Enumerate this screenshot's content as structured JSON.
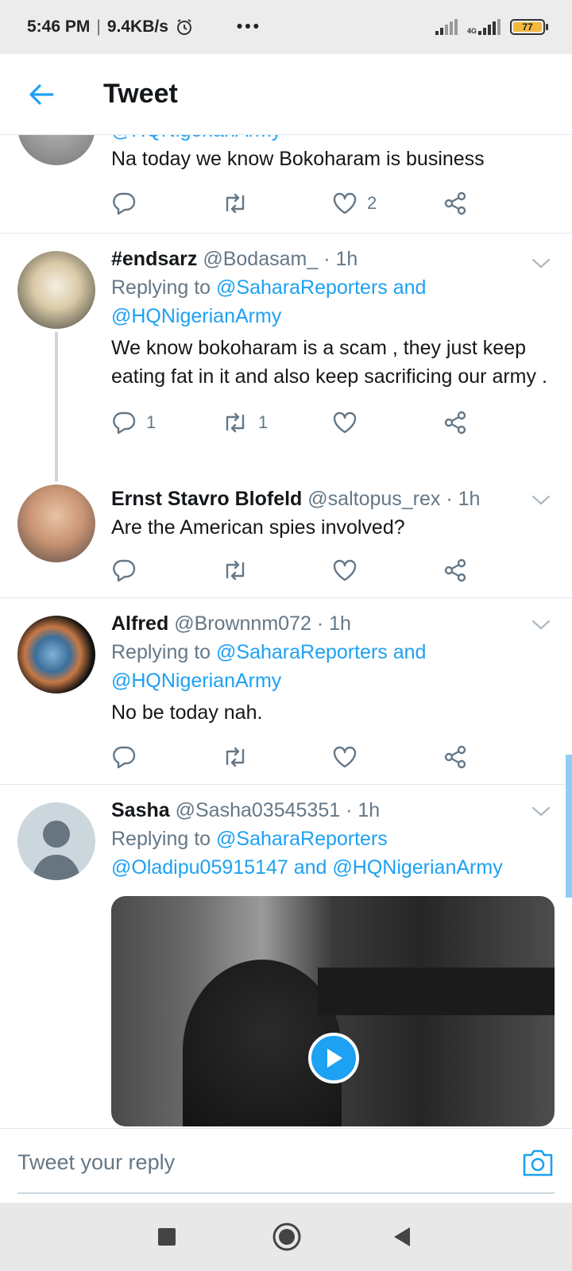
{
  "status_bar": {
    "time": "5:46 PM",
    "separator": "|",
    "speed": "9.4KB/s",
    "network_type": "4G",
    "battery": "77"
  },
  "header": {
    "title": "Tweet"
  },
  "tweets": [
    {
      "handle_partial": "@HQNigerianArmy",
      "body": "Na today we know Bokoharam is business",
      "likes": "2"
    },
    {
      "name": "#endsarz",
      "handle": "@Bodasam_",
      "time": "· 1h",
      "replying_prefix": "Replying to",
      "mentions_line1": "@SaharaReporters and",
      "mentions_line2": "@HQNigerianArmy",
      "body": "We know bokoharam is a scam , they just keep eating fat in it and also keep sacrificing our army .",
      "replies": "1",
      "retweets": "1"
    },
    {
      "name": "Ernst Stavro Blofeld",
      "handle": "@saltopus_rex",
      "time": "· 1h",
      "body": "Are the American spies involved?"
    },
    {
      "name": "Alfred",
      "handle": "@Brownnm072",
      "time": "· 1h",
      "replying_prefix": "Replying to",
      "mentions_line1": "@SaharaReporters and",
      "mentions_line2": "@HQNigerianArmy",
      "body": "No be today nah."
    },
    {
      "name": "Sasha",
      "handle": "@Sasha03545351",
      "time": "· 1h",
      "replying_prefix": "Replying to",
      "mentions_line1": "@SaharaReporters",
      "mentions_line2": "@Oladipu05915147 and @HQNigerianArmy"
    }
  ],
  "composer": {
    "placeholder": "Tweet your reply"
  },
  "colors": {
    "accent": "#1da1f2",
    "secondary_text": "#657786",
    "divider": "#e1e8ed"
  }
}
